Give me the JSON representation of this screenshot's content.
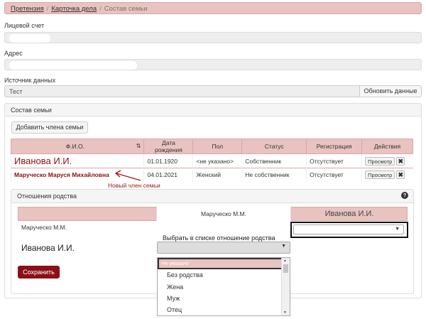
{
  "breadcrumb": {
    "items": [
      "Претензия",
      "Карточка дела"
    ],
    "current": "Состав семьи"
  },
  "fields": {
    "account_label": "Лицевой счет",
    "address_label": "Адрес",
    "source_label": "Источник данных",
    "source_value": "Тест",
    "refresh_button": "Обновить данные"
  },
  "family": {
    "title": "Состав семьи",
    "add_button": "Добавить члена семьи",
    "columns": [
      "Ф.И.О.",
      "Дата рождения",
      "Пол",
      "Статус",
      "Регистрация",
      "Действия"
    ],
    "rows": [
      {
        "name": "Иванова И.И.",
        "birth": "01.01.1920",
        "gender": "<не указано>",
        "status": "Собственник",
        "reg": "Отсутствует",
        "view": "Просмотр"
      },
      {
        "name": "Маруческо Маруся Михайловна",
        "birth": "04.01.2021",
        "gender": "Женский",
        "status": "Не собственник",
        "reg": "Отсутствует",
        "view": "Просмотр"
      }
    ],
    "annotation": "Новый член семьи"
  },
  "relations": {
    "title": "Отношения родства",
    "col1": "Маруческо М.М.",
    "col2": "Иванова И.И.",
    "row1": "Маруческо М.М.",
    "row2": "Иванова И.И.",
    "hint": "Выбрать в списке отношение родства",
    "options": [
      "Не указано",
      "Без родства",
      "Жена",
      "Муж",
      "Отец"
    ],
    "save_button": "Сохранить"
  },
  "colors": {
    "accent": "#e8c3c0",
    "brand": "#8b0f17"
  }
}
